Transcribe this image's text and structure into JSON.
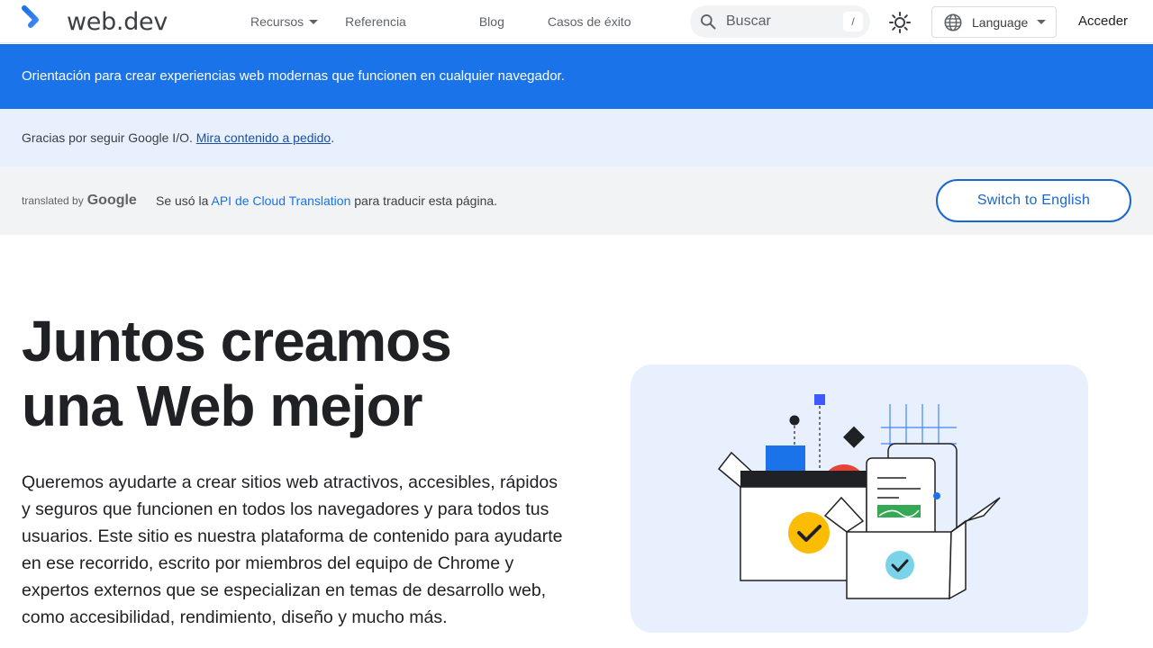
{
  "header": {
    "site_name": "web.dev",
    "nav": [
      {
        "label": "Recursos",
        "has_dropdown": true
      },
      {
        "label": "Referencia"
      },
      {
        "label": "Blog"
      },
      {
        "label": "Casos de éxito"
      }
    ],
    "search": {
      "placeholder": "Buscar",
      "shortcut": "/"
    },
    "language_label": "Language",
    "signin_label": "Acceder"
  },
  "banner": {
    "tagline": "Orientación para crear experiencias web modernas que funcionen en cualquier navegador."
  },
  "notice": {
    "text": "Gracias por seguir Google I/O. ",
    "link": "Mira contenido a pedido",
    "suffix": "."
  },
  "translation": {
    "translated_by": "translated by",
    "brand": "Google",
    "msg_prefix": "Se usó la ",
    "msg_link": "API de Cloud Translation",
    "msg_suffix": " para traducir esta página.",
    "switch_label": "Switch to English"
  },
  "hero": {
    "title_line1": "Juntos creamos",
    "title_line2": "una Web mejor",
    "body": "Queremos ayudarte a crear sitios web atractivos, accesibles, rápidos y seguros que funcionen en todos los navegadores y para todos tus usuarios. Este sitio es nuestra plataforma de contenido para ayudarte en ese recorrido, escrito por miembros del equipo de Chrome y expertos externos que se especializan en temas de desarrollo web, como accesibilidad, rendimiento, diseño y mucho más."
  },
  "colors": {
    "brand_blue": "#1a73e8",
    "notice_bg": "#e8f0fe",
    "translation_bg": "#f1f3f4"
  },
  "icons": {
    "logo": "web-dev-logo",
    "search": "search-icon",
    "theme": "sun-icon",
    "language": "globe-icon"
  }
}
